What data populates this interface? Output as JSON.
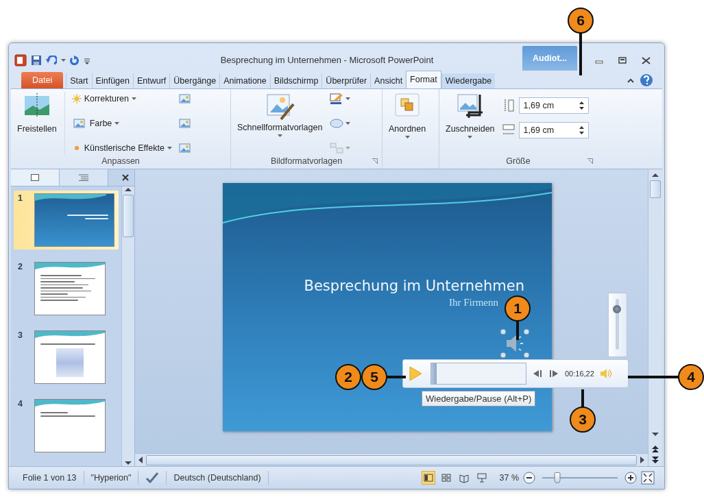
{
  "window": {
    "title": "Besprechung im Unternehmen - Microsoft PowerPoint",
    "contextual_tab": "Audiot..."
  },
  "tabs": [
    {
      "label": "Datei",
      "kind": "file",
      "selected": false
    },
    {
      "label": "Start",
      "kind": "normal",
      "selected": false
    },
    {
      "label": "Einfügen",
      "kind": "normal",
      "selected": false
    },
    {
      "label": "Entwurf",
      "kind": "normal",
      "selected": false
    },
    {
      "label": "Übergänge",
      "kind": "normal",
      "selected": false
    },
    {
      "label": "Animatione",
      "kind": "normal",
      "selected": false
    },
    {
      "label": "Bildschirmp",
      "kind": "normal",
      "selected": false
    },
    {
      "label": "Überprüfer",
      "kind": "normal",
      "selected": false
    },
    {
      "label": "Ansicht",
      "kind": "normal",
      "selected": false
    },
    {
      "label": "Format",
      "kind": "contextual",
      "selected": true
    },
    {
      "label": "Wiedergabe",
      "kind": "contextual",
      "selected": false
    }
  ],
  "ribbon": {
    "adjust": {
      "label": "Anpassen",
      "large_button": "Freistellen",
      "items": [
        "Korrekturen",
        "Farbe",
        "Künstlerische Effekte"
      ]
    },
    "picture_styles": {
      "label": "Bildformatvorlagen",
      "large_button": "Schnellformatvorlagen"
    },
    "arrange": {
      "large_button": "Anordnen"
    },
    "size": {
      "label": "Größe",
      "large_button": "Zuschneiden",
      "height": "1,69 cm",
      "width": "1,69 cm"
    }
  },
  "slides": [
    {
      "number": "1",
      "kind": "title",
      "selected": true
    },
    {
      "number": "2",
      "kind": "bullets",
      "selected": false
    },
    {
      "number": "3",
      "kind": "diagram",
      "selected": false
    },
    {
      "number": "4",
      "kind": "text",
      "selected": false
    }
  ],
  "slide": {
    "title": "Besprechung im Unternehmen",
    "subtitle": "Ihr Firmenn"
  },
  "media_player": {
    "level": 0.02,
    "time": "00:16,22",
    "tooltip": "Wiedergabe/Pause (Alt+P)",
    "volume": {
      "level": 0.8
    }
  },
  "status_bar": {
    "slide": "Folie 1 von 13",
    "theme": "\"Hyperion\"",
    "language": "Deutsch (Deutschland)",
    "views": [
      {
        "kind": "normal",
        "selected": true
      },
      {
        "kind": "sorter",
        "selected": false
      },
      {
        "kind": "reading",
        "selected": false
      },
      {
        "kind": "slideshow",
        "selected": false
      }
    ],
    "zoom": "37 %",
    "zoom_slider": {
      "level": 0.17
    }
  },
  "callouts": [
    {
      "number": "6"
    },
    {
      "number": "1"
    },
    {
      "number": "2"
    },
    {
      "number": "5"
    },
    {
      "number": "4"
    },
    {
      "number": "3"
    }
  ]
}
